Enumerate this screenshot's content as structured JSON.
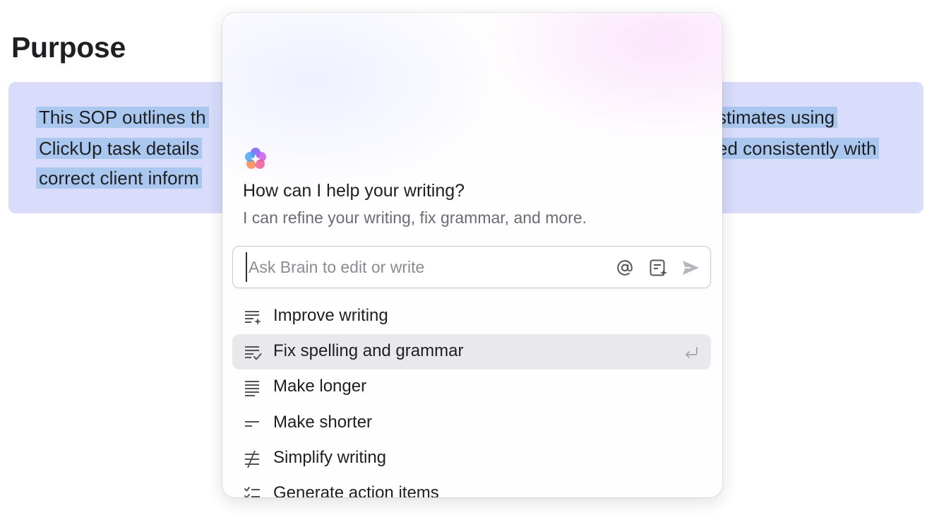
{
  "document": {
    "heading": "Purpose",
    "paragraph_lines": [
      "This SOP outlines th",
      "ClickUp task details",
      "correct client inform",
      "stimates using",
      "ed consistently with"
    ]
  },
  "brain_popup": {
    "title": "How can I help your writing?",
    "subtitle": "I can refine your writing, fix grammar, and more.",
    "input": {
      "placeholder": "Ask Brain to edit or write",
      "value": ""
    },
    "icons": {
      "mention": "at-sign-icon",
      "context": "document-sparkle-icon",
      "send": "send-icon"
    },
    "menu_items": [
      {
        "label": "Improve writing",
        "icon": "lines-sparkle-icon"
      },
      {
        "label": "Fix spelling and grammar",
        "icon": "lines-check-icon",
        "active": true
      },
      {
        "label": "Make longer",
        "icon": "lines-icon"
      },
      {
        "label": "Make shorter",
        "icon": "short-lines-icon"
      },
      {
        "label": "Simplify writing",
        "icon": "strikethrough-lines-icon"
      },
      {
        "label": "Generate action items",
        "icon": "checklist-icon"
      }
    ]
  },
  "colors": {
    "selection_block": "#dadcfc",
    "text_highlight": "#aac8ef",
    "active_item": "#e9e8ed"
  }
}
